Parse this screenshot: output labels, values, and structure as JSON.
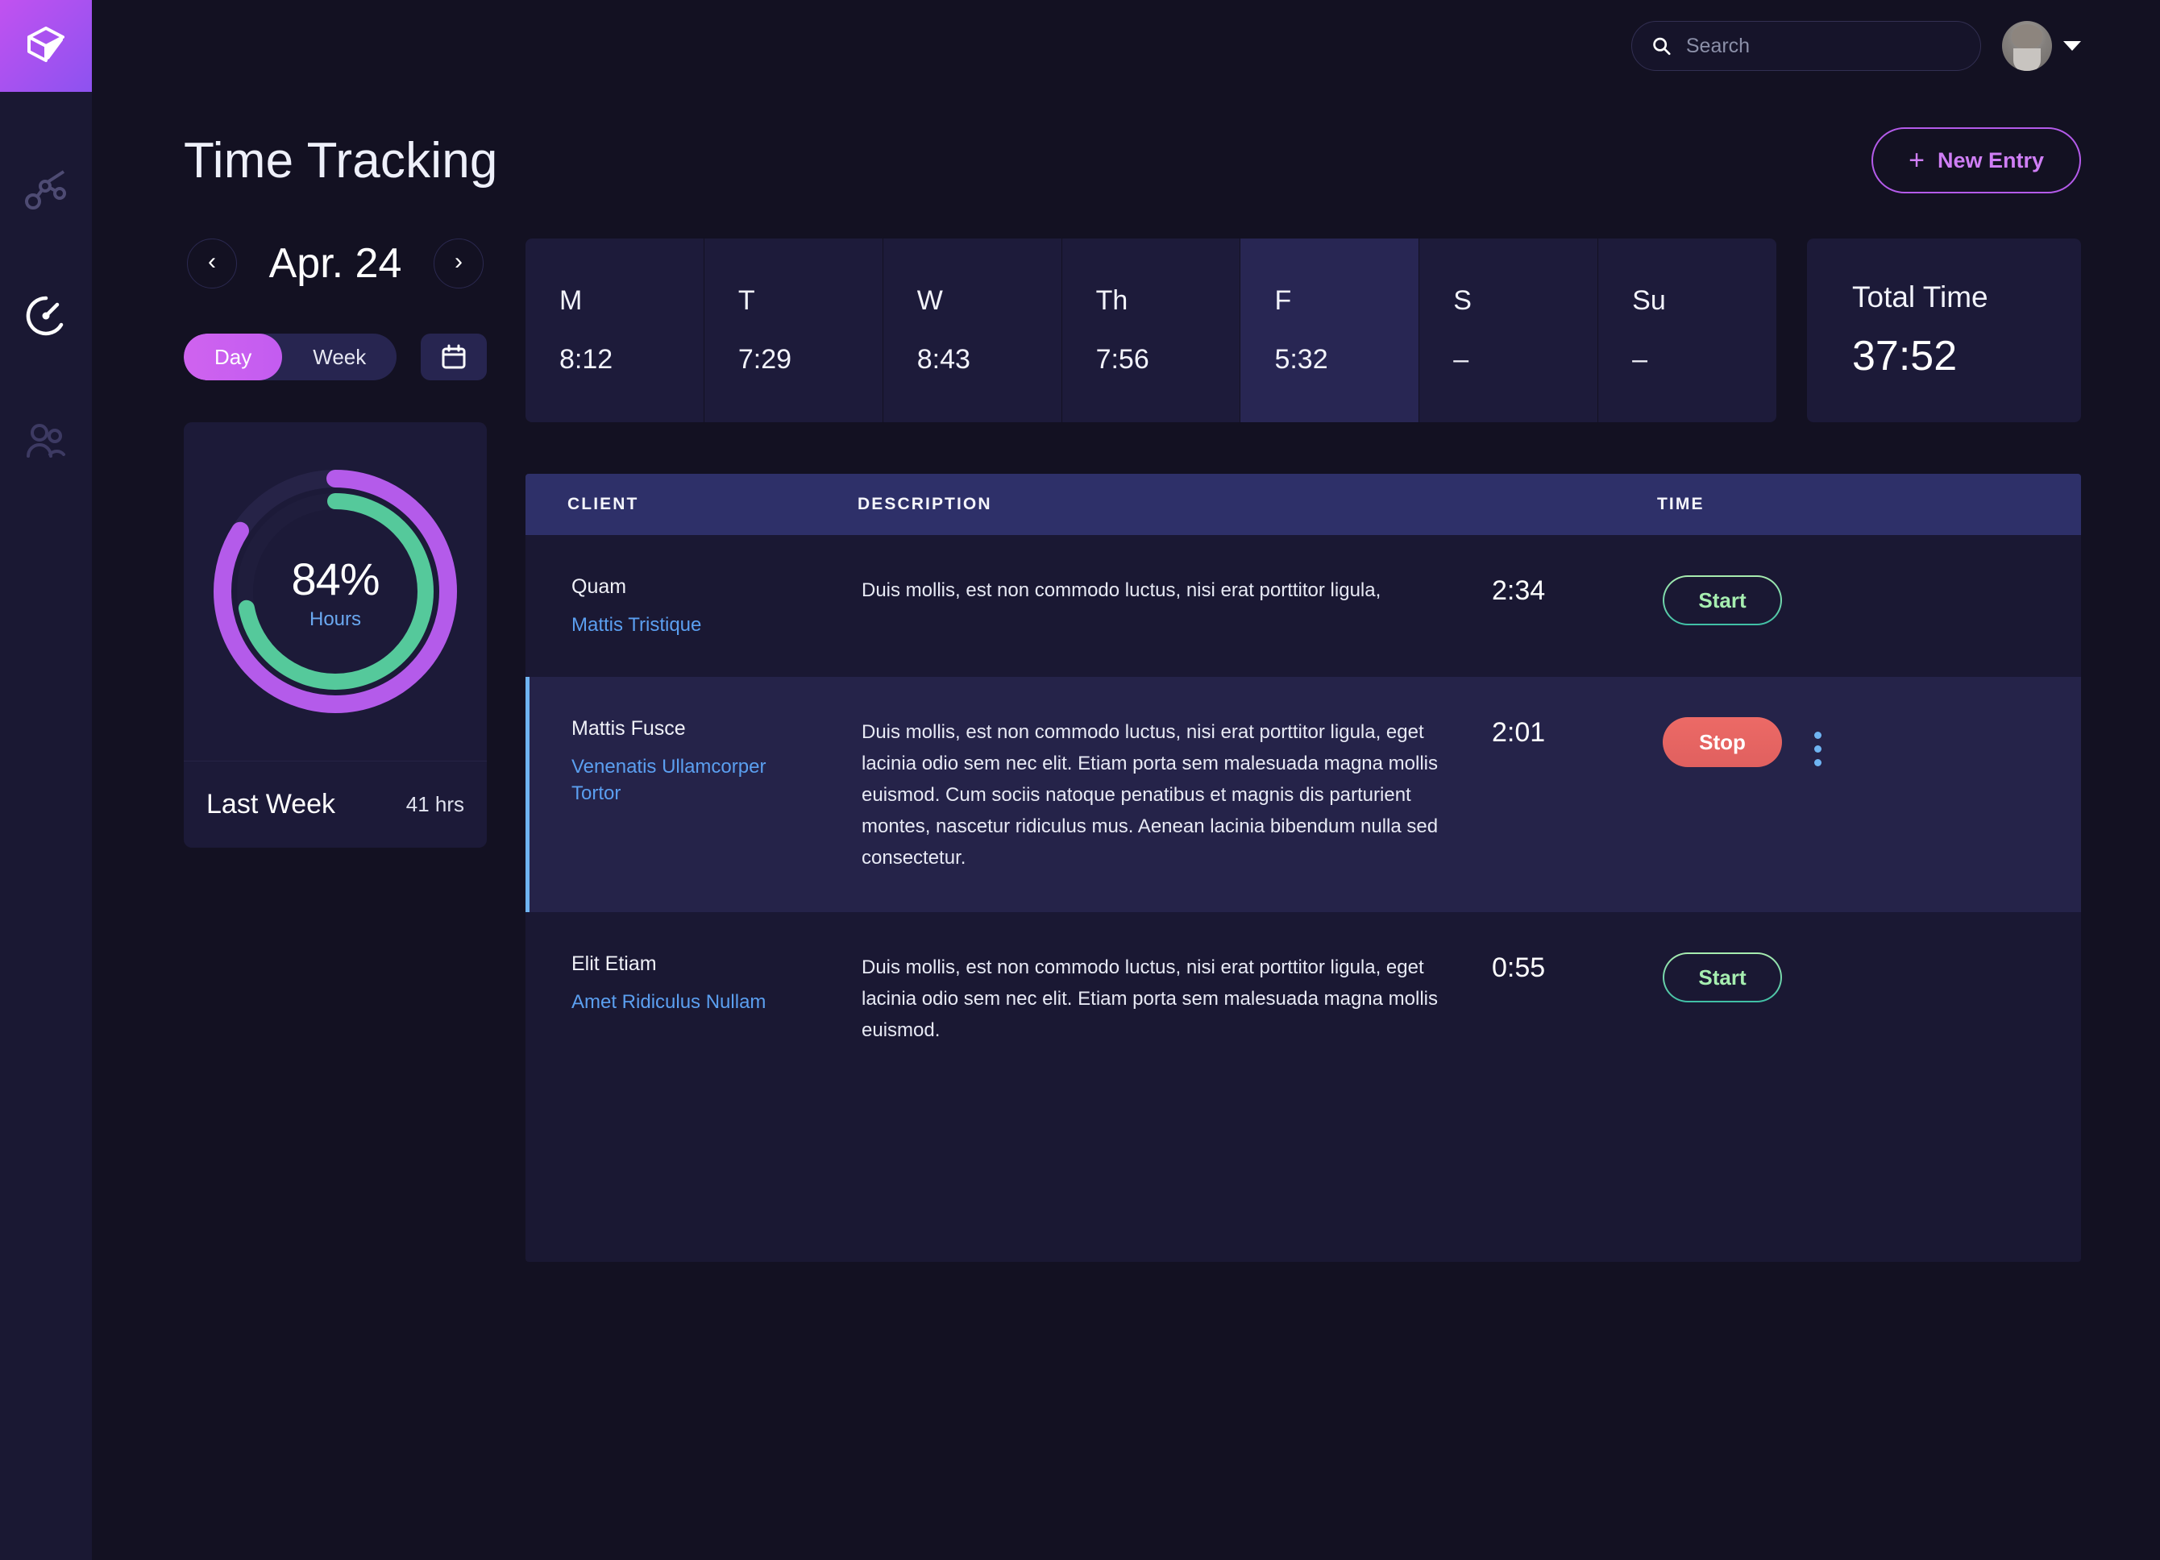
{
  "app": {
    "logo_icon": "cube-logo-icon",
    "accent_purple": "#b45bea",
    "accent_green": "#a9ecaf",
    "accent_red": "#ec6a66",
    "accent_blue": "#6fb4f2",
    "bg": "#131122",
    "sidebar_bg": "#1a1833"
  },
  "sidebar": {
    "items": [
      {
        "icon": "analytics-graph-icon",
        "label": "Analytics"
      },
      {
        "icon": "timer-gauge-icon",
        "label": "Time Tracking"
      },
      {
        "icon": "people-users-icon",
        "label": "Team"
      }
    ]
  },
  "topbar": {
    "search": {
      "icon": "search-icon",
      "value": "",
      "placeholder": "Search"
    },
    "avatar": {
      "icon": "avatar",
      "label": "User profile"
    },
    "caret": "chevron-down-icon"
  },
  "header": {
    "title": "Time Tracking",
    "new_entry_label": "New Entry",
    "new_entry_plus": "+"
  },
  "date_nav": {
    "prev_icon": "chevron-left-icon",
    "prev_glyph": "‹",
    "next_icon": "chevron-right-icon",
    "next_glyph": "›",
    "current_date": "Apr. 24"
  },
  "view_toggle": {
    "options": [
      {
        "label": "Day",
        "active": true
      },
      {
        "label": "Week",
        "active": false
      }
    ],
    "calendar_icon": "calendar-icon"
  },
  "week": {
    "days": [
      {
        "name": "M",
        "time": "8:12",
        "active": false
      },
      {
        "name": "T",
        "time": "7:29",
        "active": false
      },
      {
        "name": "W",
        "time": "8:43",
        "active": false
      },
      {
        "name": "Th",
        "time": "7:56",
        "active": false
      },
      {
        "name": "F",
        "time": "5:32",
        "active": true
      },
      {
        "name": "S",
        "time": "–",
        "active": false
      },
      {
        "name": "Su",
        "time": "–",
        "active": false
      }
    ]
  },
  "total": {
    "label": "Total Time",
    "value": "37:52"
  },
  "donut": {
    "percent_label": "84%",
    "sub_label": "Hours",
    "last_week_label": "Last Week",
    "last_week_value": "41 hrs"
  },
  "chart_data": {
    "type": "pie",
    "title": "Hours completion",
    "rings": [
      {
        "name": "Hours (outer)",
        "value": 84,
        "max": 100,
        "color": "#b45bea",
        "track": "#262347",
        "start_deg": 0
      },
      {
        "name": "Hours (inner)",
        "value": 72,
        "max": 100,
        "color": "#55c99b",
        "track": "#1f1d3c",
        "start_deg": 0
      }
    ],
    "center_value": 84,
    "center_unit": "%",
    "center_label": "Hours",
    "legend": [
      "Hours"
    ],
    "grid": false
  },
  "table": {
    "columns": [
      "CLIENT",
      "DESCRIPTION",
      "TIME",
      ""
    ],
    "rows": [
      {
        "client": "Quam",
        "project": "Mattis Tristique",
        "description": "Duis mollis, est non commodo luctus, nisi erat porttitor ligula,",
        "time": "2:34",
        "action": "Start",
        "running": false,
        "has_menu": false
      },
      {
        "client": "Mattis Fusce",
        "project": "Venenatis Ullamcorper Tortor",
        "description": "Duis mollis, est non commodo luctus, nisi erat porttitor ligula, eget lacinia odio sem nec elit. Etiam porta sem malesuada magna mollis euismod. Cum sociis natoque penatibus et magnis dis parturient montes, nascetur ridiculus mus. Aenean lacinia bibendum nulla sed consectetur.",
        "time": "2:01",
        "action": "Stop",
        "running": true,
        "has_menu": true,
        "menu_icon": "kebab-menu-icon"
      },
      {
        "client": "Elit Etiam",
        "project": "Amet Ridiculus Nullam",
        "description": "Duis mollis, est non commodo luctus, nisi erat porttitor ligula, eget lacinia odio sem nec elit. Etiam porta sem malesuada magna mollis euismod.",
        "time": "0:55",
        "action": "Start",
        "running": false,
        "has_menu": false
      }
    ]
  }
}
